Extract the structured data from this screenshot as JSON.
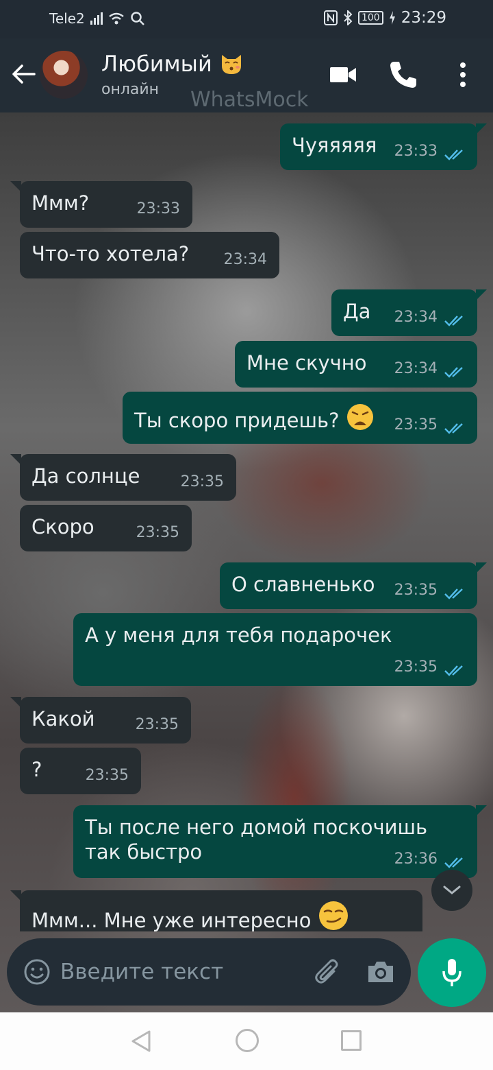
{
  "status_bar": {
    "carrier": "Tele2",
    "battery": "100",
    "time": "23:29"
  },
  "header": {
    "contact_name": "Любимый",
    "contact_emoji": "kissing-cat-emoji",
    "status": "онлайн",
    "watermark": "WhatsMock",
    "icons": [
      "back-arrow-icon",
      "video-call-icon",
      "phone-call-icon",
      "more-options-icon"
    ]
  },
  "messages": [
    {
      "direction": "out",
      "text": "Чуяяяяя",
      "time": "23:33",
      "read": true
    },
    {
      "direction": "in",
      "text": "Ммм?",
      "time": "23:33"
    },
    {
      "direction": "in",
      "text": "Что-то хотела?",
      "time": "23:34"
    },
    {
      "direction": "out",
      "text": "Да",
      "time": "23:34",
      "read": true
    },
    {
      "direction": "out",
      "text": "Мне скучно",
      "time": "23:34",
      "read": true
    },
    {
      "direction": "out",
      "text": "Ты скоро придешь?",
      "emoji": "weary-face-emoji",
      "time": "23:35",
      "read": true
    },
    {
      "direction": "in",
      "text": "Да солнце",
      "time": "23:35"
    },
    {
      "direction": "in",
      "text": "Скоро",
      "time": "23:35"
    },
    {
      "direction": "out",
      "text": "О славненько",
      "time": "23:35",
      "read": true
    },
    {
      "direction": "out",
      "text": "А у меня для тебя подарочек",
      "time": "23:35",
      "read": true
    },
    {
      "direction": "in",
      "text": "Какой",
      "time": "23:35"
    },
    {
      "direction": "in",
      "text": "?",
      "time": "23:35"
    },
    {
      "direction": "out",
      "text": "Ты после него домой поскочишь так быстро",
      "time": "23:36",
      "read": true
    },
    {
      "direction": "in",
      "text": "Ммм... Мне уже интересно",
      "emoji": "smirking-face-emoji"
    }
  ],
  "composer": {
    "placeholder": "Введите текст",
    "icons": [
      "emoji-icon",
      "attach-icon",
      "camera-icon",
      "mic-icon"
    ]
  },
  "colors": {
    "header": "#232d36",
    "incoming_bubble": "#262d31",
    "outgoing_bubble": "#054740",
    "read_ticks": "#53bdeb",
    "mic_button": "#00a884"
  }
}
